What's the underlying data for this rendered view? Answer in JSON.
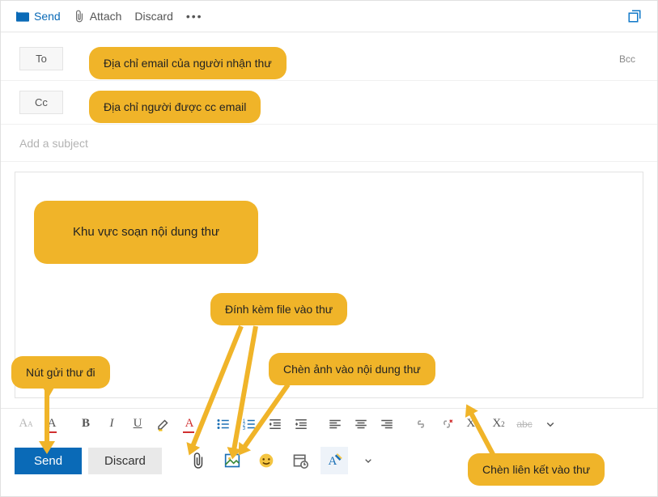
{
  "topToolbar": {
    "send": "Send",
    "attach": "Attach",
    "discard": "Discard"
  },
  "fields": {
    "toLabel": "To",
    "ccLabel": "Cc",
    "bccLabel": "Bcc",
    "subjectPlaceholder": "Add a subject"
  },
  "actionBar": {
    "send": "Send",
    "discard": "Discard"
  },
  "callouts": {
    "toHint": "Địa chỉ email của người nhận thư",
    "ccHint": "Địa chỉ người được cc email",
    "bodyHint": "Khu vực soạn nội dung thư",
    "attachHint": "Đính kèm file vào thư",
    "sendHint": "Nút gửi thư đi",
    "imageHint": "Chèn ảnh vào nội dung thư",
    "linkHint": "Chèn liên kết vào thư"
  },
  "fmt": {
    "bold": "B",
    "italic": "I",
    "underline": "U",
    "super": "X",
    "sub": "X",
    "strike": "abc"
  }
}
